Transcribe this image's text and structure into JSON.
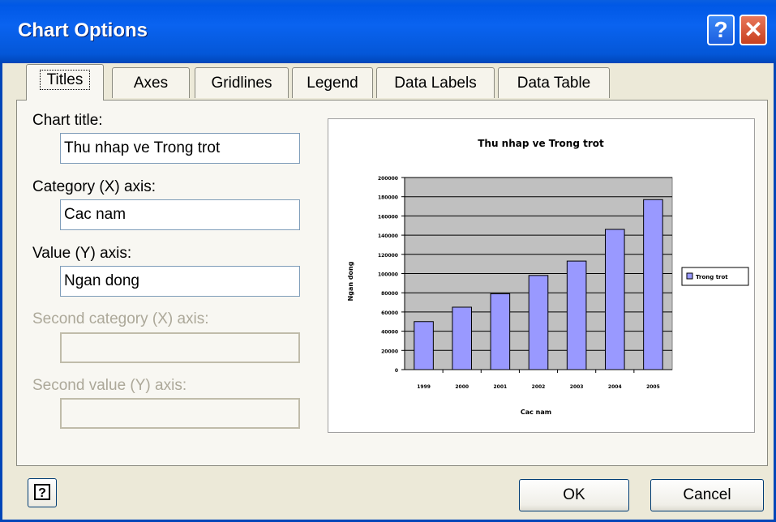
{
  "window": {
    "title": "Chart Options",
    "help_glyph": "?",
    "close_glyph": "✕"
  },
  "tabs": [
    {
      "label": "Titles",
      "active": true
    },
    {
      "label": "Axes",
      "active": false
    },
    {
      "label": "Gridlines",
      "active": false
    },
    {
      "label": "Legend",
      "active": false
    },
    {
      "label": "Data Labels",
      "active": false
    },
    {
      "label": "Data Table",
      "active": false
    }
  ],
  "fields": {
    "chart_title_label": "Chart title:",
    "chart_title_value": "Thu nhap ve Trong trot",
    "category_label": "Category (X) axis:",
    "category_value": "Cac nam",
    "value_label": "Value (Y) axis:",
    "value_value": "Ngan dong",
    "second_category_label": "Second category (X) axis:",
    "second_category_value": "",
    "second_value_label": "Second value (Y) axis:",
    "second_value_value": ""
  },
  "buttons": {
    "ok": "OK",
    "cancel": "Cancel",
    "help": "?"
  },
  "chart_data": {
    "type": "bar",
    "title": "Thu nhap ve Trong trot",
    "xlabel": "Cac nam",
    "ylabel": "Ngan dong",
    "categories": [
      "1999",
      "2000",
      "2001",
      "2002",
      "2003",
      "2004",
      "2005"
    ],
    "series": [
      {
        "name": "Trong trot",
        "values": [
          50000,
          65000,
          79000,
          98000,
          113000,
          146000,
          177000
        ]
      }
    ],
    "ylim": [
      0,
      200000
    ],
    "yticks": [
      0,
      20000,
      40000,
      60000,
      80000,
      100000,
      120000,
      140000,
      160000,
      180000,
      200000
    ],
    "grid": true,
    "legend": "right",
    "colors": {
      "bar": "#9999ff",
      "plot_bg": "#c0c0c0"
    }
  }
}
